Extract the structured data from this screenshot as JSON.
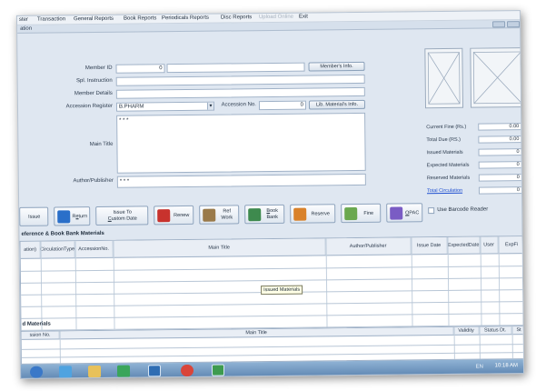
{
  "menu": [
    {
      "label": "ster",
      "disabled": false
    },
    {
      "label": "Transaction",
      "disabled": false
    },
    {
      "label": "General Reports",
      "disabled": false
    },
    {
      "label": "Book Reports",
      "disabled": false
    },
    {
      "label": "Periodicals Reports",
      "disabled": false
    },
    {
      "label": "Disc Reports",
      "disabled": false
    },
    {
      "label": "Upload Online",
      "disabled": true
    },
    {
      "label": "Exit",
      "disabled": false
    }
  ],
  "window": {
    "title": "ation"
  },
  "form": {
    "member_id_label": "Member ID",
    "member_id_value": "0",
    "members_info_button": "Member's Info.",
    "spl_instruction_label": "Spl. Instruction",
    "member_details_label": "Member Details",
    "accession_register_label": "Accession Register",
    "accession_register_value": "B.PHARM",
    "accession_no_label": "Accession No.",
    "accession_no_value": "0",
    "lib_materials_button": "Lib. Material's Info.",
    "main_title_label": "Main Title",
    "main_title_value": "* * *",
    "author_label": "Author/Publisher",
    "author_value": "* * *"
  },
  "stats": [
    {
      "label": "Current Fine (Rs.)",
      "value": "0.00"
    },
    {
      "label": "Total Due (RS.)",
      "value": "0.00"
    },
    {
      "label": "Issued Materials",
      "value": "0"
    },
    {
      "label": "Expected Materials",
      "value": "0"
    },
    {
      "label": "Reserved Materials",
      "value": "0"
    },
    {
      "label": "Total Circulation",
      "value": "0"
    }
  ],
  "toolbar": {
    "issue": "Issue",
    "return_pre": "R",
    "return_u": "e",
    "return_post": "turn",
    "issue_to_line1": "Issue To",
    "issue_to_custom_u": "C",
    "issue_to_custom_post": "ustom Date",
    "renew": "Renew",
    "ref_work_line1": "Ref",
    "ref_work_line2": "Work",
    "book_bank_u": "B",
    "book_bank_line1_post": "ook",
    "book_bank_line2": "Bank",
    "reserve": "Reserve",
    "fine": "Fine",
    "opac_u": "O",
    "opac_post": "PAC",
    "barcode_label": "Use Barcode Reader"
  },
  "section1": {
    "title": "eference & Book Bank Materials",
    "columns": [
      {
        "l1": "ation",
        "l2": ")"
      },
      {
        "l1": "Circulation",
        "l2": "Type"
      },
      {
        "l1": "Accession",
        "l2": "No."
      },
      {
        "l1": "Main Title",
        "l2": ""
      },
      {
        "l1": "Author/Publisher",
        "l2": ""
      },
      {
        "l1": "Issue Date",
        "l2": ""
      },
      {
        "l1": "Expected",
        "l2": "Date"
      },
      {
        "l1": "User",
        "l2": ""
      },
      {
        "l1": "Exp",
        "l2": "Fi"
      }
    ]
  },
  "tooltip": "Issued Materials",
  "section2": {
    "title": "d Materials",
    "columns": [
      {
        "label": "ssion No."
      },
      {
        "label": "Main Title"
      },
      {
        "label": "Validity"
      },
      {
        "label": "Status Dt."
      },
      {
        "label": "St"
      }
    ]
  },
  "taskbar": {
    "clock": "10:18 AM",
    "tray": "EN",
    "apps": [
      {
        "icon": "windows-orb-icon",
        "color": "#3a78c8"
      },
      {
        "icon": "browser-icon",
        "color": "#4fa3e0"
      },
      {
        "icon": "folder-icon",
        "color": "#e8c15a"
      },
      {
        "icon": "pen-app-icon",
        "color": "#3aa55a"
      },
      {
        "icon": "library-app-icon",
        "color": "#2f6db3"
      },
      {
        "icon": "chrome-icon",
        "color": "#d9453a"
      },
      {
        "icon": "spreadsheet-icon",
        "color": "#3e9b4f"
      }
    ]
  }
}
